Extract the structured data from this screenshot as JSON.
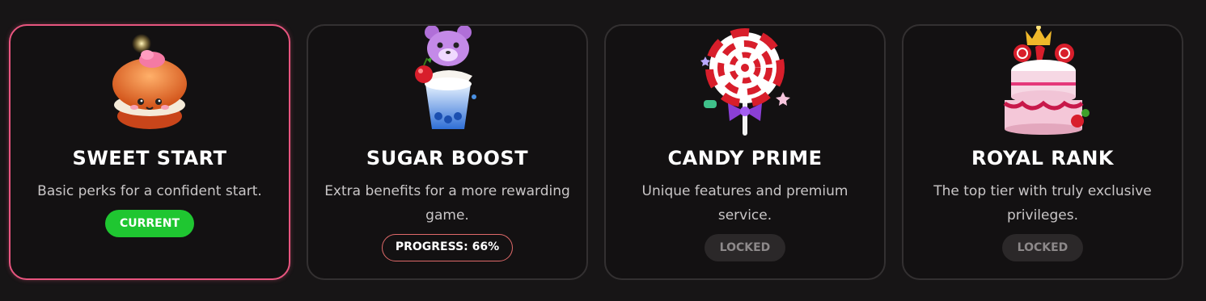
{
  "tiers": [
    {
      "title": "SWEET START",
      "description": "Basic perks for a confident start.",
      "status": "CURRENT",
      "icon": "cream-bun-icon"
    },
    {
      "title": "SUGAR BOOST",
      "description": "Extra benefits for a more rewarding game.",
      "status": "PROGRESS: 66%",
      "progress": 0.66,
      "icon": "bear-dessert-cup-icon"
    },
    {
      "title": "CANDY PRIME",
      "description": "Unique features and premium service.",
      "status": "LOCKED",
      "icon": "lollipop-icon"
    },
    {
      "title": "ROYAL RANK",
      "description": "The top tier with truly exclusive privileges.",
      "status": "LOCKED",
      "icon": "royal-cake-icon"
    }
  ],
  "colors": {
    "background": "#171516",
    "active_border": "#e8557f",
    "current_badge": "#1fc631",
    "progress_border": "#e06a6a",
    "locked_badge": "#2b2829"
  }
}
